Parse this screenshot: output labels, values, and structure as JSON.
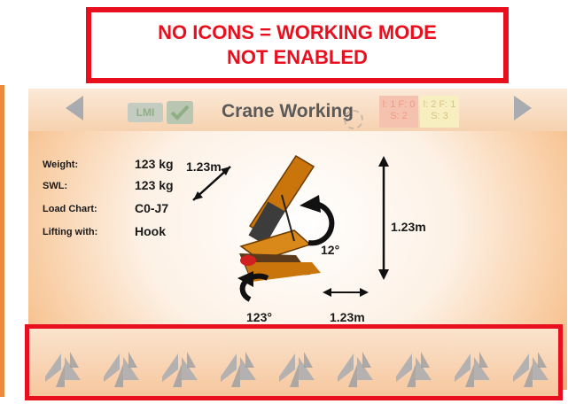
{
  "annotation": {
    "line1": "NO ICONS = WORKING MODE",
    "line2": "NOT ENABLED",
    "color": "#e8101e"
  },
  "header": {
    "title": "Crane Working",
    "lmi_label": "LMI",
    "badge_red": {
      "line1": "l: 1 F: 0",
      "line2": "S: 2"
    },
    "badge_yellow": {
      "line1": "l: 2 F: 1",
      "line2": "S: 3"
    }
  },
  "info": [
    {
      "label": "Weight:",
      "value": "123 kg"
    },
    {
      "label": "SWL:",
      "value": "123 kg"
    },
    {
      "label": "Load Chart:",
      "value": "C0-J7"
    },
    {
      "label": "Lifting with:",
      "value": "Hook"
    }
  ],
  "diagram": {
    "boom_length": "1.23m",
    "height": "1.23m",
    "reach": "1.23m",
    "boom_angle": "12°",
    "slew_angle": "123°"
  },
  "function_buttons": {
    "count": 9,
    "icon": "up-down-arrows-icon",
    "state": "disabled"
  },
  "colors": {
    "accent_orange": "#f0a56a",
    "crane_body": "#c9750c",
    "disabled_grey": "#a8abb0"
  }
}
